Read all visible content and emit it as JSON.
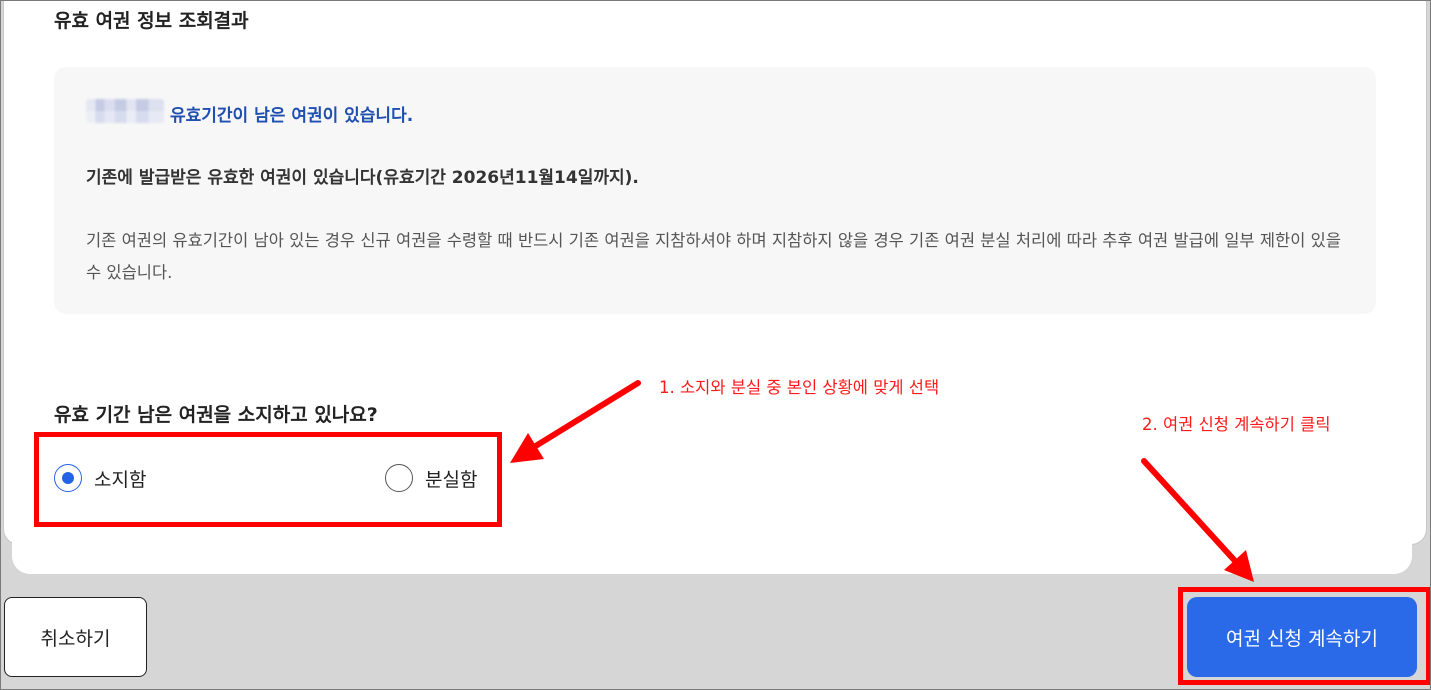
{
  "result": {
    "title": "유효 여권 정보 조회결과",
    "valid_heading": "유효기간이 남은 여권이 있습니다.",
    "detail_strong": "기존에 발급받은 유효한 여권이 있습니다(유효기간 2026년11월14일까지).",
    "detail_normal": "기존 여권의 유효기간이 남아 있는 경우 신규 여권을 수령할 때 반드시 기존 여권을 지참하셔야 하며 지참하지 않을 경우 기존 여권 분실 처리에 따라 추후 여권 발급에 일부 제한이 있을 수 있습니다."
  },
  "question": {
    "label": "유효 기간 남은 여권을 소지하고 있나요?",
    "options": [
      {
        "label": "소지함",
        "selected": true
      },
      {
        "label": "분실함",
        "selected": false
      }
    ]
  },
  "annotations": {
    "step1": "1. 소지와 분실 중 본인 상황에 맞게 선택",
    "step2": "2. 여권 신청 계속하기 클릭"
  },
  "buttons": {
    "cancel": "취소하기",
    "continue": "여권 신청 계속하기"
  },
  "colors": {
    "accent": "#2a6ae8",
    "link_blue": "#1f4fb0",
    "annotation_red": "#ff0000"
  }
}
